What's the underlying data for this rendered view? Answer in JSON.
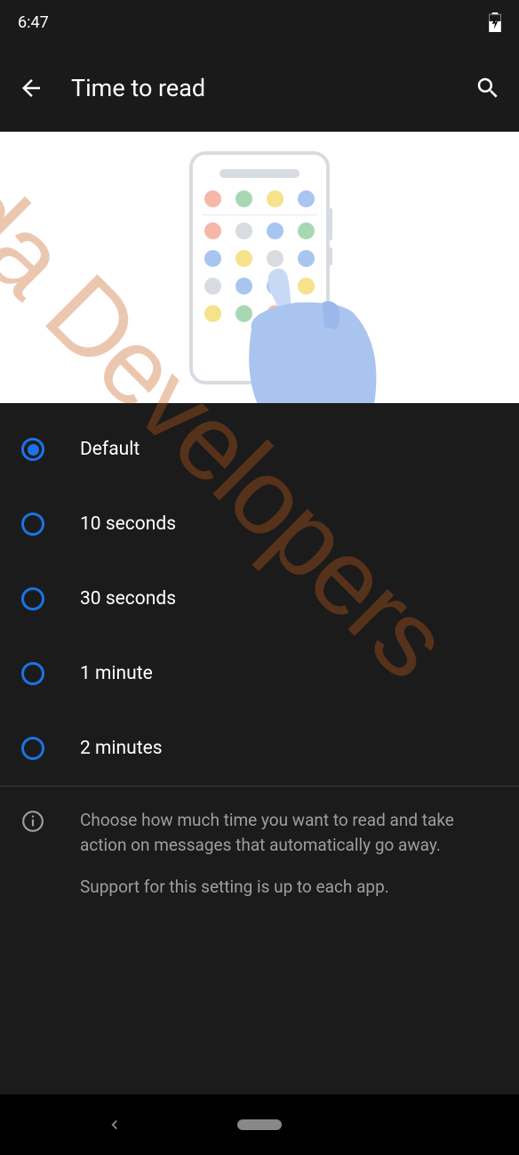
{
  "status": {
    "time": "6:47"
  },
  "header": {
    "title": "Time to read"
  },
  "options": [
    {
      "label": "Default",
      "selected": true
    },
    {
      "label": "10 seconds",
      "selected": false
    },
    {
      "label": "30 seconds",
      "selected": false
    },
    {
      "label": "1 minute",
      "selected": false
    },
    {
      "label": "2 minutes",
      "selected": false
    }
  ],
  "info": {
    "line1": "Choose how much time you want to read and take action on messages that automatically go away.",
    "line2": "Support for this setting is up to each app."
  },
  "watermark": "xda Developers"
}
